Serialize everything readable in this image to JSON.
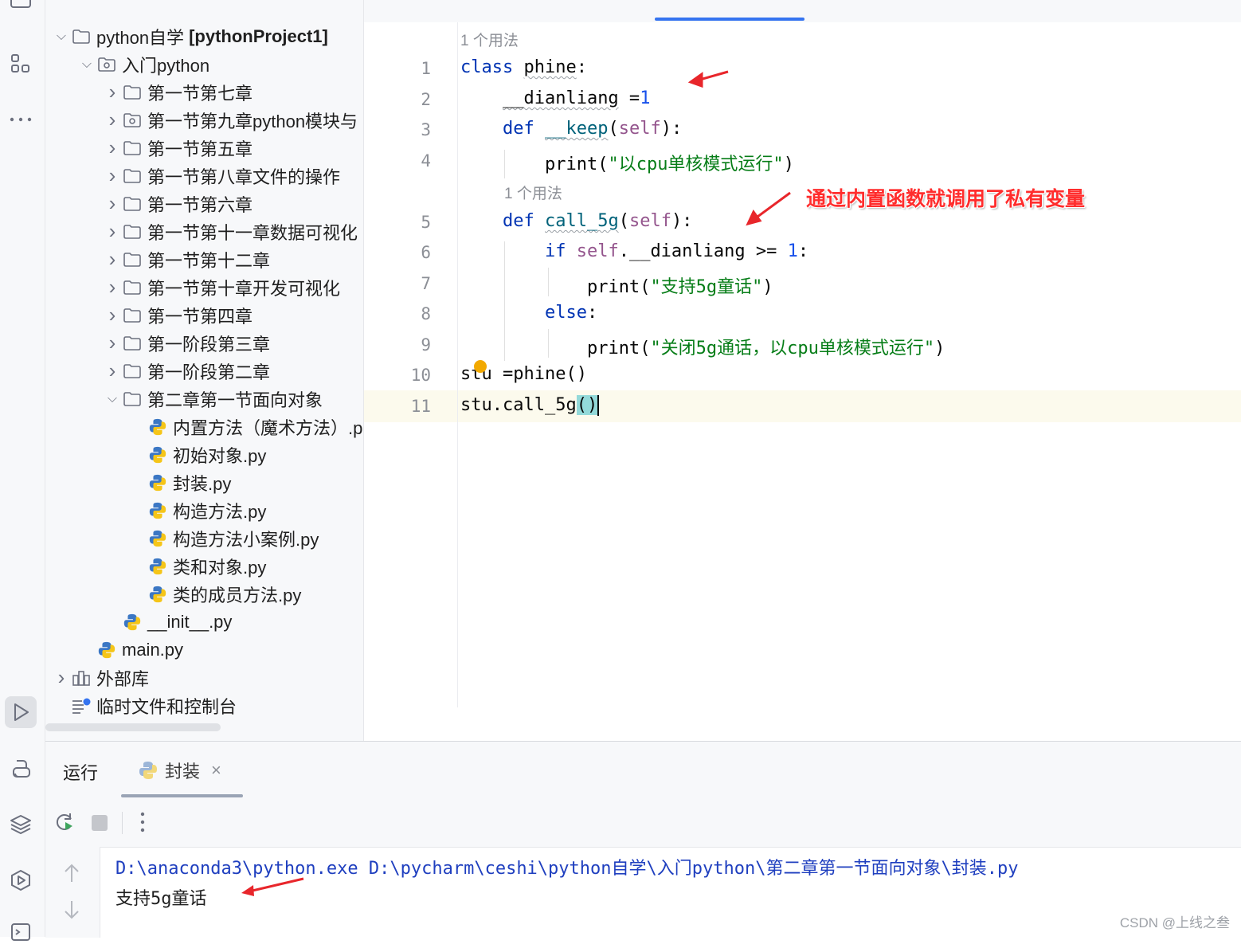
{
  "project_tree": {
    "root": {
      "name": "python自学",
      "project": "[pythonProject1]"
    },
    "items": [
      {
        "label": "入门python",
        "type": "package",
        "level": 1,
        "expanded": true
      },
      {
        "label": "第一节第七章",
        "type": "folder",
        "level": 2
      },
      {
        "label": "第一节第九章python模块与",
        "type": "package",
        "level": 2
      },
      {
        "label": "第一节第五章",
        "type": "folder",
        "level": 2
      },
      {
        "label": "第一节第八章文件的操作",
        "type": "folder",
        "level": 2
      },
      {
        "label": "第一节第六章",
        "type": "folder",
        "level": 2
      },
      {
        "label": "第一节第十一章数据可视化",
        "type": "folder",
        "level": 2
      },
      {
        "label": "第一节第十二章",
        "type": "folder",
        "level": 2
      },
      {
        "label": "第一节第十章开发可视化",
        "type": "folder",
        "level": 2
      },
      {
        "label": "第一节第四章",
        "type": "folder",
        "level": 2
      },
      {
        "label": "第一阶段第三章",
        "type": "folder",
        "level": 2
      },
      {
        "label": "第一阶段第二章",
        "type": "folder",
        "level": 2
      },
      {
        "label": "第二章第一节面向对象",
        "type": "folder",
        "level": 2,
        "expanded": true
      },
      {
        "label": "内置方法（魔术方法）.p",
        "type": "py",
        "level": 3
      },
      {
        "label": "初始对象.py",
        "type": "py",
        "level": 3
      },
      {
        "label": "封装.py",
        "type": "py",
        "level": 3
      },
      {
        "label": "构造方法.py",
        "type": "py",
        "level": 3
      },
      {
        "label": "构造方法小案例.py",
        "type": "py",
        "level": 3
      },
      {
        "label": "类和对象.py",
        "type": "py",
        "level": 3,
        "selected": true
      },
      {
        "label": "类的成员方法.py",
        "type": "py",
        "level": 3
      },
      {
        "label": "__init__.py",
        "type": "py",
        "level": 2
      },
      {
        "label": "main.py",
        "type": "py",
        "level": 1
      },
      {
        "label": "外部库",
        "type": "library",
        "level": 0
      },
      {
        "label": "临时文件和控制台",
        "type": "scratch",
        "level": 0
      }
    ]
  },
  "editor": {
    "usage_hint_1": "1 个用法",
    "usage_hint_2": "1 个用法",
    "line_numbers": [
      "1",
      "2",
      "3",
      "4",
      "5",
      "6",
      "7",
      "8",
      "9",
      "10",
      "11"
    ],
    "code": {
      "l1_kw": "class",
      "l1_name": "phine",
      "l1_colon": ":",
      "l2_var": "__dianliang",
      "l2_eq": " =",
      "l2_num": "1",
      "l3_kw": "def",
      "l3_name": "__keep",
      "l3_open": "(",
      "l3_self": "self",
      "l3_close": "):",
      "l4_fn": "print",
      "l4_open": "(",
      "l4_str": "\"以cpu单核模式运行\"",
      "l4_close": ")",
      "l5_kw": "def",
      "l5_name": "call_5g",
      "l5_open": "(",
      "l5_self": "self",
      "l5_close": "):",
      "l6_kw": "if",
      "l6_self": "self",
      "l6_attr": ".__dianliang >= ",
      "l6_num": "1",
      "l6_colon": ":",
      "l7_fn": "print",
      "l7_open": "(",
      "l7_str": "\"支持5g童话\"",
      "l7_close": ")",
      "l8_kw": "else",
      "l8_colon": ":",
      "l9_fn": "print",
      "l9_open": "(",
      "l9_str": "\"关闭5g通话，以cpu单核模式运行\"",
      "l9_close": ")",
      "l10": "stu =phine()",
      "l11_pre": "stu.call_5g",
      "l11_parens": "()"
    }
  },
  "annotation": {
    "text": "通过内置函数就调用了私有变量"
  },
  "run_panel": {
    "title": "运行",
    "tab_label": "封装",
    "console": {
      "command": "D:\\anaconda3\\python.exe D:\\pycharm\\ceshi\\python自学\\入门python\\第二章第一节面向对象\\封装.py",
      "output": "支持5g童话"
    }
  },
  "watermark": "CSDN @上线之叁",
  "colors": {
    "accent": "#3574f0",
    "keyword": "#0033b3",
    "string": "#067d17",
    "number": "#1750eb",
    "annotation_red": "#ff2d2d"
  }
}
